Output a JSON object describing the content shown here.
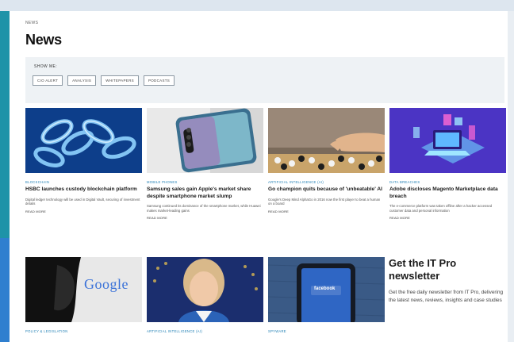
{
  "breadcrumb": "NEWS",
  "page_title": "News",
  "filter": {
    "label": "SHOW ME:",
    "chips": [
      "CIO ALERT",
      "ANALYSIS",
      "WHITEPAPERS",
      "PODCASTS"
    ]
  },
  "articles": [
    {
      "category": "BLOCKCHAIN",
      "title": "HSBC launches custody blockchain platform",
      "blurb": "Digital ledger technology will be used in Digital Vault, securing of investment details",
      "readmore": "READ MORE"
    },
    {
      "category": "MOBILE PHONES",
      "title": "Samsung sales gain Apple's market share despite smartphone market slump",
      "blurb": "Samsung continued its dominance of the smartphone market, while Huawei makes market-leading gains",
      "readmore": "READ MORE"
    },
    {
      "category": "ARTIFICIAL INTELLIGENCE (AI)",
      "title": "Go champion quits because of 'unbeatable' AI",
      "blurb": "Google's Deep Mind AlphaGo in 2016 now the first player to beat a human on a board",
      "readmore": "READ MORE"
    },
    {
      "category": "DATA BREACHES",
      "title": "Adobe discloses Magento Marketplace data breach",
      "blurb": "The e-commerce platform was taken offline after a hacker accessed customer data and personal information",
      "readmore": "READ MORE"
    },
    {
      "category": "POLICY & LEGISLATION",
      "title": "",
      "blurb": "",
      "readmore": ""
    },
    {
      "category": "ARTIFICIAL INTELLIGENCE (AI)",
      "title": "",
      "blurb": "",
      "readmore": ""
    },
    {
      "category": "SPYWARE",
      "title": "",
      "blurb": "",
      "readmore": ""
    }
  ],
  "newsletter": {
    "title": "Get the IT Pro newsletter",
    "text": "Get the free daily newsletter from IT Pro, delivering the latest news, reviews, insights and case studies"
  },
  "thumb_texts": {
    "google": "Google",
    "facebook": "facebook"
  },
  "colors": {
    "accent_teal": "#1e93a8",
    "accent_blue": "#2f7fcf",
    "category_blue": "#1f7fb4"
  }
}
